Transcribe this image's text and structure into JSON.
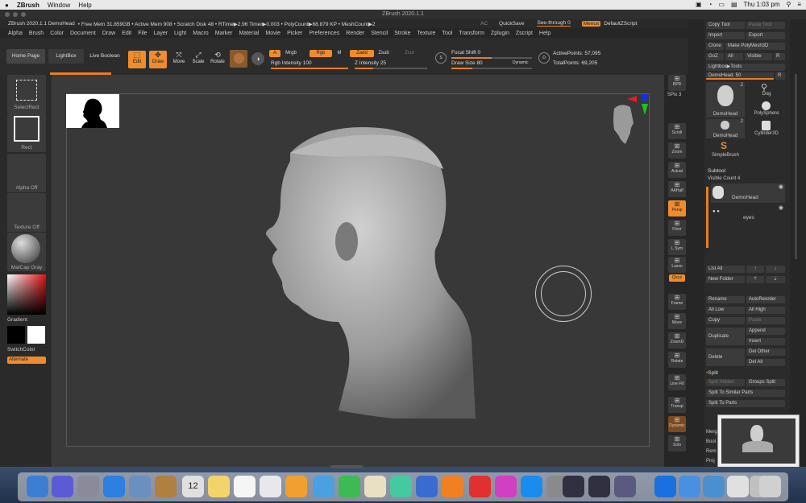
{
  "menubar": {
    "app": "ZBrush",
    "items": [
      "Window",
      "Help"
    ],
    "clock": "Thu 1:03 pm"
  },
  "window": {
    "title": "ZBrush 2020.1.1"
  },
  "infobar": {
    "doc": "ZBrush 2020.1.1 DemoHead",
    "stats": "• Free Mem 31.859GB • Active Mem 908 • Scratch Disk 48 • RTime▶2.96 Timer▶0.003 • PolyCount▶68.879 KP • MeshCount▶2",
    "ac": "AC",
    "quicksave": "QuickSave",
    "seethrough": "See-through",
    "seethrough_value": "0",
    "menus_btn": "Menus",
    "script": "DefaultZScript"
  },
  "menus": [
    "Alpha",
    "Brush",
    "Color",
    "Document",
    "Draw",
    "Edit",
    "File",
    "Layer",
    "Light",
    "Macro",
    "Marker",
    "Material",
    "Movie",
    "Picker",
    "Preferences",
    "Render",
    "Stencil",
    "Stroke",
    "Texture",
    "Tool",
    "Transform",
    "Zplugin",
    "Zscript",
    "Help"
  ],
  "topshelf": {
    "home": "Home Page",
    "lightbox": "LightBox",
    "liveboolean": "Live Boolean",
    "edit": "Edit",
    "draw": "Draw",
    "move": "Move",
    "scale": "Scale",
    "rotate": "Rotate",
    "a": "A",
    "mrgb": "Mrgb",
    "rgb": "Rgb",
    "m": "M",
    "zadd": "Zadd",
    "zsub": "Zsub",
    "zcut": "Zcut",
    "rgb_intensity": "Rgb Intensity",
    "rgb_intensity_value": "100",
    "rgb_intensity_level": 1.0,
    "z_intensity": "Z Intensity",
    "z_intensity_value": "25",
    "z_intensity_level": 0.25,
    "focal": "Focal Shift",
    "focal_value": "0",
    "focal_level": 0.5,
    "drawsize": "Draw Size",
    "drawsize_value": "80",
    "drawsize_level": 0.26,
    "dynamic": "Dynamic",
    "activepoints": "ActivePoints: 57,095",
    "totalpoints": "TotalPoints: 69,205"
  },
  "leftshelf": {
    "selectrect": "SelectRect",
    "rect": "Rect",
    "alpha": "Alpha Off",
    "texture": "Texture Off",
    "matcap": "MatCap Gray",
    "gradient": "Gradient",
    "switch": "SwitchColor",
    "alternate": "Alternate"
  },
  "rshelf": {
    "buttons": [
      "BPR",
      "Scroll",
      "Zoom",
      "Actual",
      "AAHalf",
      "Persp",
      "Floor",
      "L.Sym",
      "Lasso",
      "Frame",
      "Move",
      "ZoomD",
      "Rotate",
      "Line Fill",
      "Transp",
      "Dynamic",
      "Solo"
    ],
    "spix": "SPix 3",
    "xyz": "Qxyz"
  },
  "tray": {
    "row1": [
      "Copy Tool",
      "Paste Tool"
    ],
    "row2": [
      "Import",
      "Export"
    ],
    "row3": [
      "Clone",
      "Make PolyMesh3D"
    ],
    "row4": [
      "GoZ",
      "All",
      "Visible",
      "R"
    ],
    "lightbox_tools": "Lightbox▶Tools",
    "demohead": "DemoHead. 50",
    "demohead_r": "R",
    "tools": [
      "DemoHead",
      "Dog",
      "PolySphere",
      "DemoHead",
      "Cylinder3D",
      "SimpleBrush"
    ],
    "tool_counts": [
      "2",
      "2"
    ],
    "subtool": "Subtool",
    "visible": "Visible Count 4",
    "subtools": [
      "DemoHead",
      "eyes"
    ],
    "listall": "List All",
    "newfolder": "New Folder",
    "rename": "Rename",
    "autoreorder": "AutoReorder",
    "alllow": "All Low",
    "allhigh": "All High",
    "copy": "Copy",
    "paste": "Paste",
    "duplicate": "Duplicate",
    "append": "Append",
    "insert": "Insert",
    "delete": "Delete",
    "delother": "Del Other",
    "delall": "Del All",
    "split": "Split",
    "splithidden": "Split Hidden",
    "groupssplit": "Groups Split",
    "splitsimilar": "Split To Similar Parts",
    "splitparts": "Split To Parts",
    "merge": "Merg",
    "boolean": "Bool",
    "remesh": "Rem",
    "project": "Proj"
  },
  "colors": {
    "orange": "#f08c2c",
    "panel": "#2b2b2b",
    "canvas": "#383838"
  }
}
